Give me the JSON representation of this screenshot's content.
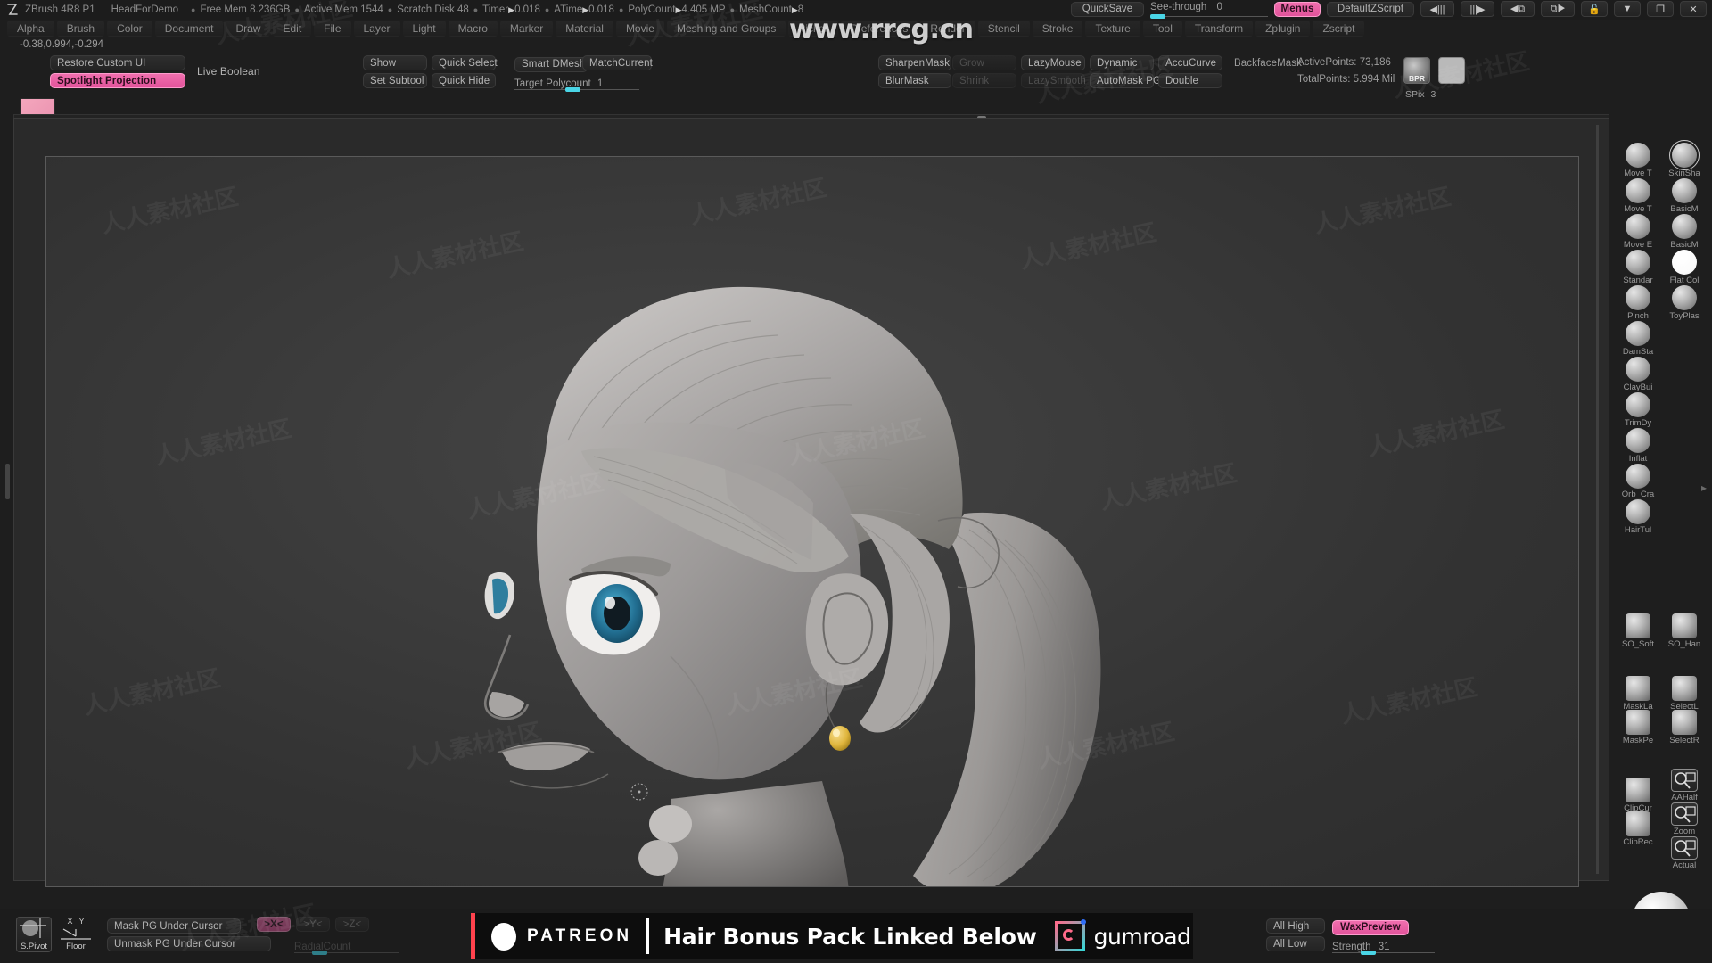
{
  "app": {
    "version_label": "ZBrush 4R8 P1",
    "document_name": "HeadForDemo",
    "coords_readout": "-0.38,0.994,-0.294",
    "logo_icon": "zbrush-logo-icon"
  },
  "status": {
    "items": [
      {
        "label": "Free Mem 8.236GB"
      },
      {
        "label": "Active Mem 1544"
      },
      {
        "label": "Scratch Disk 48"
      },
      {
        "label": "Timer",
        "arrow": true,
        "value": "0.018"
      },
      {
        "label": "ATime",
        "arrow": true,
        "value": "0.018"
      },
      {
        "label": "PolyCount",
        "arrow": true,
        "value": "4.405 MP"
      },
      {
        "label": "MeshCount",
        "arrow": true,
        "value": "8"
      }
    ],
    "quicksave": "QuickSave",
    "see_through_label": "See-through",
    "see_through_value": "0",
    "menus_button": "Menus",
    "zscript": "DefaultZScript",
    "window_icons": [
      "prev-palette-icon",
      "next-palette-icon",
      "prev-subtool-icon",
      "next-subtool-icon",
      "lock-icon",
      "minimize-icon",
      "restore-icon",
      "close-icon"
    ]
  },
  "menubar": {
    "items": [
      "Alpha",
      "Brush",
      "Color",
      "Document",
      "Draw",
      "Edit",
      "File",
      "Layer",
      "Light",
      "Macro",
      "Marker",
      "Material",
      "Movie",
      "Meshing and Groups",
      "Picker",
      "Preferences",
      "Render",
      "Stencil",
      "Stroke",
      "Texture",
      "Tool",
      "Transform",
      "Zplugin",
      "Zscript"
    ]
  },
  "watermark": {
    "site": "www.rrcg.cn",
    "tile_text": "人人素材社区"
  },
  "shelf": {
    "ui_group": {
      "restore": "Restore Custom UI",
      "spotlight": "Spotlight Projection",
      "live_boolean": "Live Boolean",
      "thumb_icon": "document-thumbnail-icon"
    },
    "visibility_group": {
      "show": "Show",
      "set_subtool": "Set Subtool",
      "quick_select": "Quick Select",
      "quick_hide": "Quick Hide"
    },
    "dynamesh_group": {
      "smart_dmesh": "Smart DMesh",
      "match_current": "MatchCurrent",
      "target_polycount_label": "Target Polycount",
      "target_polycount_value": "1"
    },
    "mask_group": {
      "sharpen_mask": "SharpenMask",
      "blur_mask": "BlurMask",
      "grow": "Grow",
      "shrink": "Shrink"
    },
    "stroke_group": {
      "lazy_mouse": "LazyMouse",
      "lazy_smooth": "LazySmooth",
      "dynamic": "Dynamic",
      "automask_pg": "AutoMask PG",
      "accucurve": "AccuCurve",
      "double": "Double",
      "backface_mask": "BackfaceMask"
    },
    "points": {
      "active_label": "ActivePoints:",
      "active_value": "73,186",
      "total_label": "TotalPoints:",
      "total_value": "5.994 Mil"
    },
    "render": {
      "bpr_label": "BPR",
      "bpr_icon": "bpr-render-icon",
      "preview_icon": "render-preview-swatch",
      "spix_label": "SPix",
      "spix_value": "3"
    }
  },
  "brushes": [
    {
      "name": "Move T",
      "icon": "brush-move-topological-icon",
      "selected": false
    },
    {
      "name": "Move T",
      "icon": "brush-move-icon",
      "selected": false
    },
    {
      "name": "Move E",
      "icon": "brush-move-elastic-icon",
      "selected": false
    },
    {
      "name": "Standar",
      "icon": "brush-standard-icon",
      "selected": false
    },
    {
      "name": "Pinch",
      "icon": "brush-pinch-icon",
      "selected": false
    },
    {
      "name": "DamSta",
      "icon": "brush-damstandard-icon",
      "selected": false
    },
    {
      "name": "ClayBui",
      "icon": "brush-claybuildup-icon",
      "selected": false
    },
    {
      "name": "TrimDy",
      "icon": "brush-trimdynamic-icon",
      "selected": false
    },
    {
      "name": "Inflat",
      "icon": "brush-inflate-icon",
      "selected": false
    },
    {
      "name": "Orb_Cra",
      "icon": "brush-orb-cracks-icon",
      "selected": false
    },
    {
      "name": "HairTul",
      "icon": "brush-hairtubes-icon",
      "selected": false
    }
  ],
  "materials": [
    {
      "name": "SkinSha",
      "icon": "material-skinshade-icon",
      "selected": true
    },
    {
      "name": "BasicM",
      "icon": "material-basic-icon",
      "selected": false
    },
    {
      "name": "BasicM",
      "icon": "material-basic2-icon",
      "selected": false
    },
    {
      "name": "Flat Col",
      "icon": "material-flatcolor-icon",
      "selected": false
    },
    {
      "name": "ToyPlas",
      "icon": "material-toyplastic-icon",
      "selected": false
    }
  ],
  "strokes": [
    {
      "name": "SO_Soft",
      "icon": "stroke-so-soft-icon"
    },
    {
      "name": "SO_Han",
      "icon": "stroke-so-hard-icon"
    }
  ],
  "masking": [
    {
      "name": "MaskLa",
      "icon": "mask-lasso-icon"
    },
    {
      "name": "SelectL",
      "icon": "select-lasso-icon"
    },
    {
      "name": "MaskPe",
      "icon": "mask-pen-icon"
    },
    {
      "name": "SelectR",
      "icon": "select-rect-icon"
    }
  ],
  "clip_tools": [
    {
      "name": "ClipCur",
      "icon": "clip-curve-icon"
    },
    {
      "name": "ClipRec",
      "icon": "clip-rect-icon"
    }
  ],
  "zoom_tools": [
    {
      "name": "AAHalf",
      "icon": "aahalf-icon"
    },
    {
      "name": "Zoom",
      "icon": "zoom-icon"
    },
    {
      "name": "Actual",
      "icon": "actual-size-icon"
    }
  ],
  "viewport": {
    "model_description": "3D sculpted cartoon female head with braided hair and long ponytail",
    "eye_color": "#2a7c9c",
    "earring_color": "#e8c24a",
    "background_color": "#3a3a3a"
  },
  "bottombar": {
    "s_pivot": "S.Pivot",
    "floor": "Floor",
    "floor_axis_x": "X",
    "floor_axis_y": "Y",
    "mask_pg": "Mask PG Under Cursor",
    "unmask_pg": "Unmask PG Under Cursor",
    "xyz_x": ">X<",
    "xyz_y": ">Y<",
    "xyz_z": ">Z<",
    "radial_count_label": "RadialCount",
    "all_high": "All High",
    "all_low": "All Low",
    "wax_preview": "WaxPreview",
    "strength_label": "Strength",
    "strength_value": "31",
    "nav_ball_icon": "navigation-sphere-icon"
  },
  "promo": {
    "patreon": "PATREON",
    "headline": "Hair Bonus Pack Linked Below",
    "gumroad": "gumroad",
    "patreon_color": "#ff424d",
    "gumroad_color": "#36d6d6"
  }
}
